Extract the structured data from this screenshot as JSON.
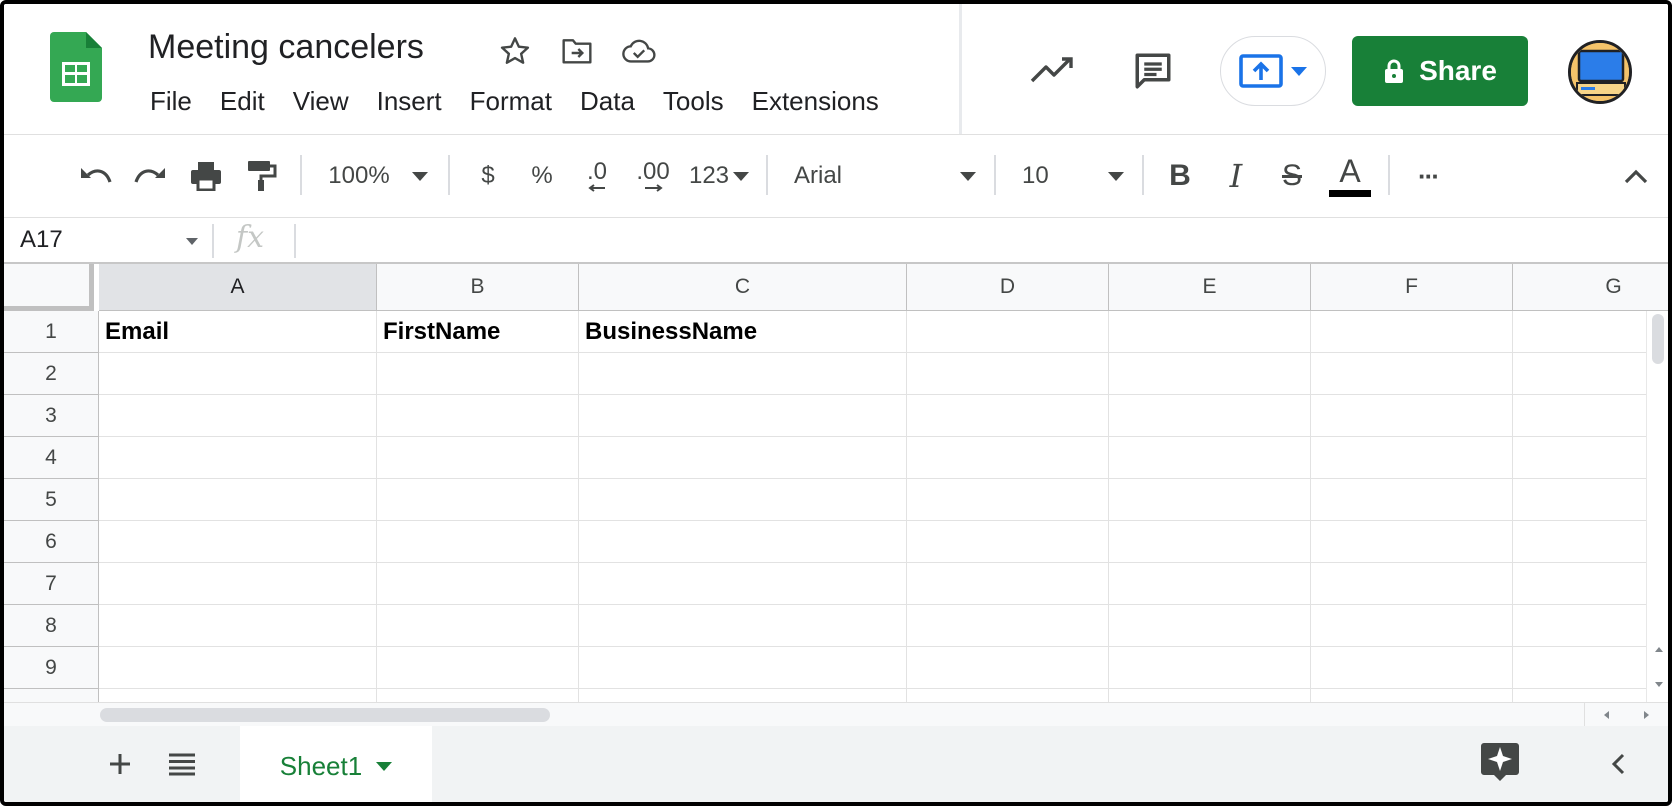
{
  "app": {
    "name": "Google Sheets",
    "title": "Meeting cancelers",
    "title_icons": [
      "star-icon",
      "move-to-folder-icon",
      "cloud-saved-icon"
    ]
  },
  "menu": [
    "File",
    "Edit",
    "View",
    "Insert",
    "Format",
    "Data",
    "Tools",
    "Extensions"
  ],
  "header": {
    "share_label": "Share",
    "icons": [
      "activity-trend-icon",
      "comments-icon",
      "present-icon",
      "lock-icon",
      "avatar"
    ]
  },
  "toolbar": {
    "zoom": "100%",
    "currency": "$",
    "percent": "%",
    "decrease_decimal": ".0",
    "increase_decimal": ".00",
    "more_formats": "123",
    "font": "Arial",
    "font_size": "10",
    "bold": "B",
    "italic": "I",
    "strikethrough": "S",
    "text_color": "A",
    "more": "···"
  },
  "formula_bar": {
    "name_box": "A17",
    "fx": "fx",
    "value": ""
  },
  "columns": [
    "A",
    "B",
    "C",
    "D",
    "E",
    "F",
    "G"
  ],
  "selected_column": "A",
  "rows": [
    "1",
    "2",
    "3",
    "4",
    "5",
    "6",
    "7",
    "8",
    "9"
  ],
  "cells": {
    "A1": "Email",
    "B1": "FirstName",
    "C1": "BusinessName"
  },
  "sheets": [
    {
      "name": "Sheet1",
      "active": true
    }
  ],
  "colors": {
    "brand_green": "#188038",
    "logo_green": "#34A853",
    "present_blue": "#1A73E8"
  }
}
